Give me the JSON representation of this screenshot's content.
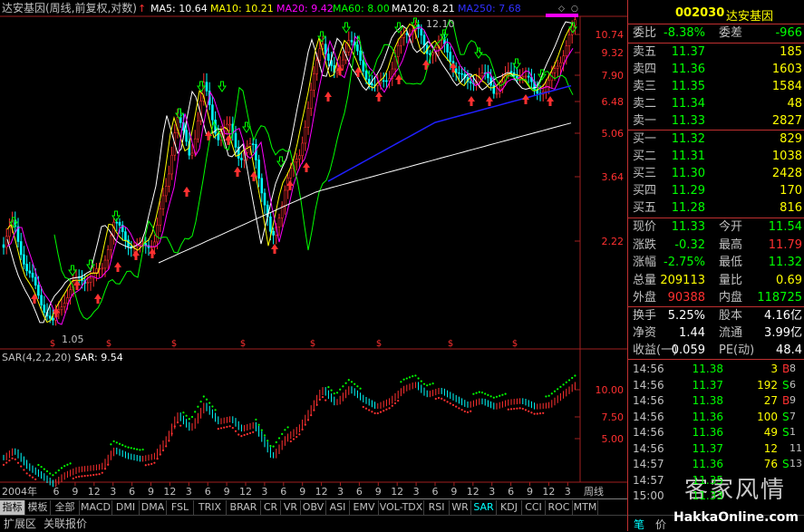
{
  "header": {
    "title": "达安基因(周线,前复权,对数)",
    "ma": [
      {
        "label": "MA5: 10.64",
        "color": "#ffffff"
      },
      {
        "label": "MA10: 10.21",
        "color": "#ffff00"
      },
      {
        "label": "MA20: 9.42",
        "color": "#ff00ff"
      },
      {
        "label": "MA60: 8.00",
        "color": "#00ff00"
      },
      {
        "label": "MA120: 8.21",
        "color": "#ffffff"
      },
      {
        "label": "MA250: 7.68",
        "color": "#3030ff"
      }
    ],
    "high_label": "12.10",
    "low_label": "1.05"
  },
  "axis": {
    "price_ticks": [
      "10.74",
      "9.32",
      "7.90",
      "6.48",
      "5.06",
      "3.64",
      "2.22"
    ],
    "sar_ticks": [
      "10.00",
      "7.50",
      "5.00"
    ],
    "year_label": "2004年",
    "x_ticks": [
      "6",
      "9",
      "12",
      "3",
      "6",
      "9",
      "12",
      "3",
      "6",
      "9",
      "12",
      "3",
      "6",
      "9",
      "12",
      "3",
      "6",
      "9",
      "12",
      "3",
      "6",
      "9",
      "12",
      "3",
      "6",
      "9",
      "12",
      "3"
    ],
    "period": "周线"
  },
  "sar": {
    "label": "SAR(4,2,2,20)",
    "value": "SAR: 9.54"
  },
  "quote": {
    "code": "002030",
    "name": "达安基因",
    "weibi_label": "委比",
    "weibi": "-8.38%",
    "weicha_label": "委差",
    "weicha": "-966",
    "sell": [
      {
        "label": "卖五",
        "price": "11.37",
        "vol": "185"
      },
      {
        "label": "卖四",
        "price": "11.36",
        "vol": "1603"
      },
      {
        "label": "卖三",
        "price": "11.35",
        "vol": "1584"
      },
      {
        "label": "卖二",
        "price": "11.34",
        "vol": "48"
      },
      {
        "label": "卖一",
        "price": "11.33",
        "vol": "2827"
      }
    ],
    "buy": [
      {
        "label": "买一",
        "price": "11.32",
        "vol": "829"
      },
      {
        "label": "买二",
        "price": "11.31",
        "vol": "1038"
      },
      {
        "label": "买三",
        "price": "11.30",
        "vol": "2428"
      },
      {
        "label": "买四",
        "price": "11.29",
        "vol": "170"
      },
      {
        "label": "买五",
        "price": "11.28",
        "vol": "816"
      }
    ],
    "stats": [
      {
        "l1": "现价",
        "v1": "11.33",
        "c1": "#00ff00",
        "l2": "今开",
        "v2": "11.54",
        "c2": "#00ff00"
      },
      {
        "l1": "涨跌",
        "v1": "-0.32",
        "c1": "#00ff00",
        "l2": "最高",
        "v2": "11.79",
        "c2": "#ff3030"
      },
      {
        "l1": "涨幅",
        "v1": "-2.75%",
        "c1": "#00ff00",
        "l2": "最低",
        "v2": "11.32",
        "c2": "#00ff00"
      },
      {
        "l1": "总量",
        "v1": "209113",
        "c1": "#ffff00",
        "l2": "量比",
        "v2": "0.69",
        "c2": "#ffff00"
      },
      {
        "l1": "外盘",
        "v1": "90388",
        "c1": "#ff3030",
        "l2": "内盘",
        "v2": "118725",
        "c2": "#00ff00"
      }
    ],
    "stats2": [
      {
        "l1": "换手",
        "v1": "5.25%",
        "l2": "股本",
        "v2": "4.16亿"
      },
      {
        "l1": "净资",
        "v1": "1.44",
        "l2": "流通",
        "v2": "3.99亿"
      },
      {
        "l1": "收益(一)",
        "v1": "0.059",
        "l2": "PE(动)",
        "v2": "48.4"
      }
    ],
    "ticks": [
      {
        "t": "14:56",
        "p": "11.38",
        "q": "3",
        "d": "B"
      },
      {
        "t": "14:56",
        "p": "11.37",
        "q": "192",
        "d": "S"
      },
      {
        "t": "14:56",
        "p": "11.38",
        "q": "27",
        "d": "B"
      },
      {
        "t": "14:56",
        "p": "11.36",
        "q": "100",
        "d": "S"
      },
      {
        "t": "14:56",
        "p": "11.36",
        "q": "49",
        "d": "S"
      },
      {
        "t": "14:56",
        "p": "11.37",
        "q": "12",
        "d": ""
      },
      {
        "t": "14:57",
        "p": "11.36",
        "q": "76",
        "d": "S"
      },
      {
        "t": "14:57",
        "p": "11.35",
        "q": "",
        "d": ""
      },
      {
        "t": "15:00",
        "p": "11.33",
        "q": "",
        "d": ""
      }
    ],
    "right_edge": [
      "8",
      "6",
      "9",
      "7",
      "1",
      "11",
      "13"
    ]
  },
  "tabs": [
    "指标",
    "模板",
    "全部",
    "MACD",
    "DMI",
    "DMA",
    "FSL",
    "TRIX",
    "BRAR",
    "CR",
    "VR",
    "OBV",
    "ASI",
    "EMV",
    "VOL-TDX",
    "RSI",
    "WR",
    "SAR",
    "KDJ",
    "CCI",
    "ROC",
    "MTM"
  ],
  "active_tab": "SAR",
  "tabs2": [
    "扩展区",
    "关联报价"
  ],
  "bottom_right": [
    "笔",
    "价"
  ],
  "watermark": {
    "script": "客家风情",
    "site": "HakkaOnline.com"
  }
}
